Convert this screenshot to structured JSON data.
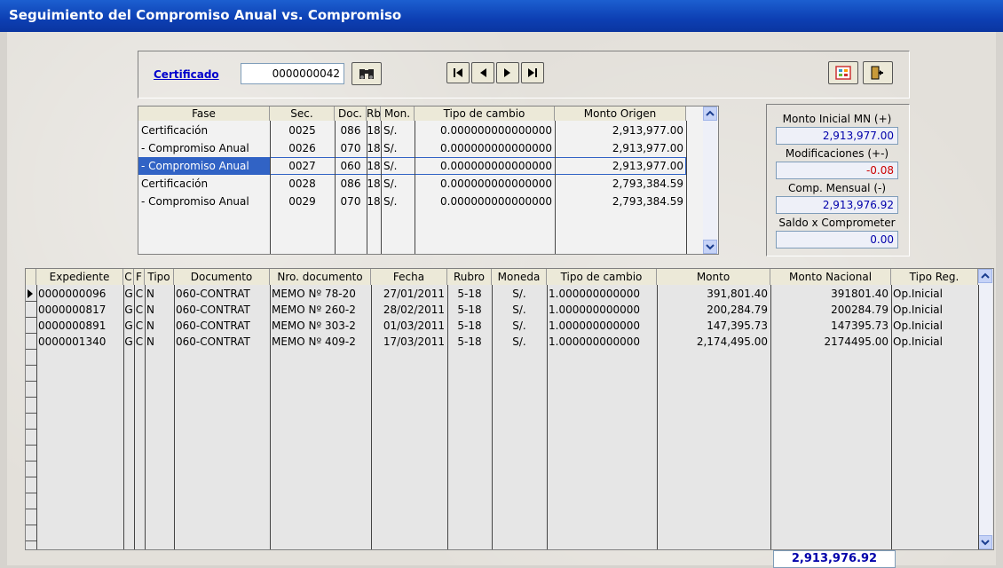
{
  "window": {
    "title": "Seguimiento del Compromiso Anual vs. Compromiso"
  },
  "certificado": {
    "label": "Certificado",
    "value": "0000000042"
  },
  "icons": {
    "search": "binoculars-icon",
    "first": "first-record-icon",
    "prev": "previous-record-icon",
    "next": "next-record-icon",
    "last": "last-record-icon",
    "print": "report-icon",
    "exit": "exit-icon"
  },
  "phases": {
    "headers": [
      "Fase",
      "Sec.",
      "Doc.",
      "Rb.",
      "Mon.",
      "Tipo de cambio",
      "Monto Origen"
    ],
    "rows": [
      [
        "Certificación",
        "0025",
        "086",
        "18",
        "S/.",
        "0.000000000000000",
        "2,913,977.00"
      ],
      [
        " - Compromiso Anual",
        "0026",
        "070",
        "18",
        "S/.",
        "0.000000000000000",
        "2,913,977.00"
      ],
      [
        " - Compromiso Anual",
        "0027",
        "060",
        "18",
        "S/.",
        "0.000000000000000",
        "2,913,977.00"
      ],
      [
        "Certificación",
        "0028",
        "086",
        "18",
        "S/.",
        "0.000000000000000",
        "2,793,384.59"
      ],
      [
        " - Compromiso Anual",
        "0029",
        "070",
        "18",
        "S/.",
        "0.000000000000000",
        "2,793,384.59"
      ]
    ],
    "selected_row": 2
  },
  "summary": {
    "monto_inicial_label": "Monto Inicial MN (+)",
    "monto_inicial_value": "2,913,977.00",
    "modificaciones_label": "Modificaciones (+-)",
    "modificaciones_value": "-0.08",
    "comp_mensual_label": "Comp. Mensual (-)",
    "comp_mensual_value": "2,913,976.92",
    "saldo_label": "Saldo x Comprometer",
    "saldo_value": "0.00"
  },
  "detail": {
    "headers": [
      "Expediente",
      "C",
      "F",
      "Tipo",
      "Documento",
      "Nro. documento",
      "Fecha",
      "Rubro",
      "Moneda",
      "Tipo de cambio",
      "Monto",
      "Monto Nacional",
      "Tipo Reg."
    ],
    "rows": [
      [
        "0000000096",
        "G",
        "C",
        "N",
        "060-CONTRAT",
        "MEMO Nº 78-20",
        "27/01/2011",
        "5-18",
        "S/.",
        "1.000000000000",
        "391,801.40",
        "391801.40",
        "Op.Inicial"
      ],
      [
        "0000000817",
        "G",
        "C",
        "N",
        "060-CONTRAT",
        "MEMO Nº 260-2",
        "28/02/2011",
        "5-18",
        "S/.",
        "1.000000000000",
        "200,284.79",
        "200284.79",
        "Op.Inicial"
      ],
      [
        "0000000891",
        "G",
        "C",
        "N",
        "060-CONTRAT",
        "MEMO Nº 303-2",
        "01/03/2011",
        "5-18",
        "S/.",
        "1.000000000000",
        "147,395.73",
        "147395.73",
        "Op.Inicial"
      ],
      [
        "0000001340",
        "G",
        "C",
        "N",
        "060-CONTRAT",
        "MEMO Nº 409-2",
        "17/03/2011",
        "5-18",
        "S/.",
        "1.000000000000",
        "2,174,495.00",
        "2174495.00",
        "Op.Inicial"
      ]
    ],
    "total": "2,913,976.92"
  },
  "colors": {
    "title_bar": "#0d3fb3",
    "selection": "#3163c5",
    "negative": "#cc0000",
    "link": "#0000cc"
  }
}
